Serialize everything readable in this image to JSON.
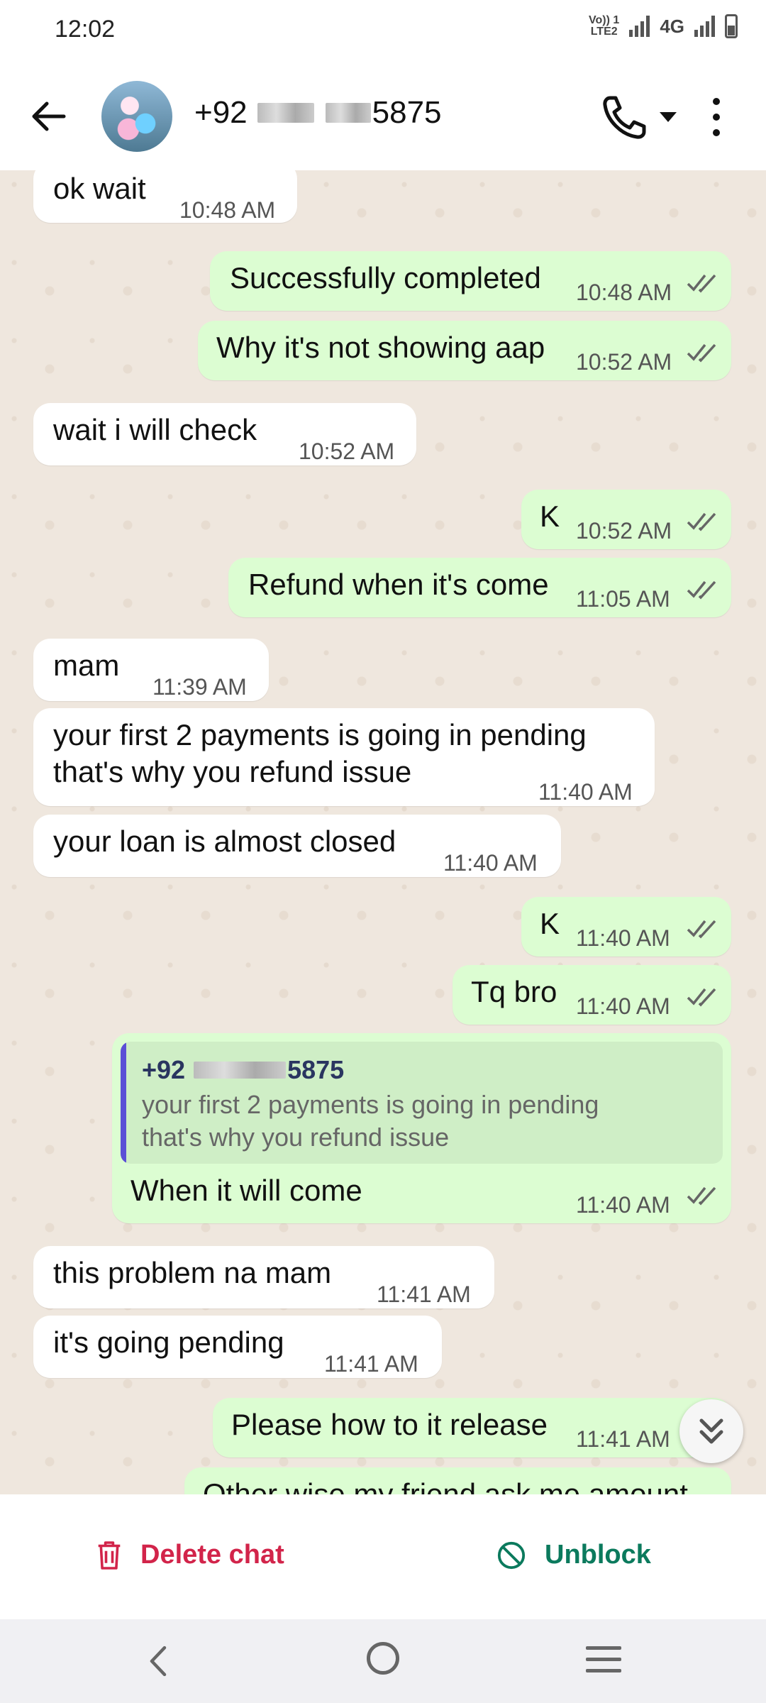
{
  "status_bar": {
    "time": "12:02",
    "volte": "Vo)) 1",
    "lte": "LTE2",
    "network": "4G"
  },
  "header": {
    "contact_prefix": "+92",
    "contact_suffix": "5875"
  },
  "messages": [
    {
      "dir": "in",
      "text": "ok wait",
      "time": "10:48 AM"
    },
    {
      "dir": "out",
      "text": "Successfully completed",
      "time": "10:48 AM"
    },
    {
      "dir": "out",
      "text": "Why it's not showing aap",
      "time": "10:52 AM"
    },
    {
      "dir": "in",
      "text": "wait i will check",
      "time": "10:52 AM"
    },
    {
      "dir": "out",
      "text": "K",
      "time": "10:52 AM"
    },
    {
      "dir": "out",
      "text": "Refund when it's come",
      "time": "11:05 AM"
    },
    {
      "dir": "in",
      "text": "mam",
      "time": "11:39 AM"
    },
    {
      "dir": "in",
      "line1": "your first 2 payments is going in pending",
      "line2": "that's why you refund issue",
      "time": "11:40 AM"
    },
    {
      "dir": "in",
      "text": "your loan is almost closed",
      "time": "11:40 AM"
    },
    {
      "dir": "out",
      "text": "K",
      "time": "11:40 AM"
    },
    {
      "dir": "out",
      "text": "Tq bro",
      "time": "11:40 AM"
    },
    {
      "dir": "out",
      "quote_name_prefix": "+92",
      "quote_name_suffix": "5875",
      "quote_line1": "your first 2 payments is going in pending",
      "quote_line2": "that's why you refund issue",
      "text": "When it will come",
      "time": "11:40 AM"
    },
    {
      "dir": "in",
      "text": "this problem na mam",
      "time": "11:41 AM"
    },
    {
      "dir": "in",
      "text": "it's going pending",
      "time": "11:41 AM"
    },
    {
      "dir": "out",
      "text": "Please how to it release",
      "time": "11:41 AM"
    },
    {
      "dir": "out",
      "text": "Other wise my friend ask me amount",
      "time": ""
    }
  ],
  "actions": {
    "delete_label": "Delete chat",
    "unblock_label": "Unblock"
  },
  "colors": {
    "outgoing": "#dcfdd2",
    "incoming": "#ffffff",
    "delete": "#d2244a",
    "unblock": "#0b7a5d",
    "quote_bar": "#5b4fd6"
  }
}
